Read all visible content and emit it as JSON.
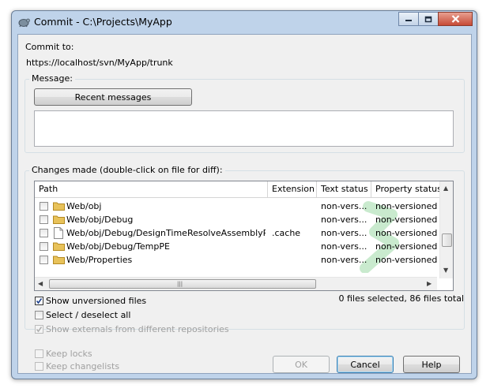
{
  "window": {
    "title": "Commit - C:\\Projects\\MyApp"
  },
  "commit_to": {
    "label": "Commit to:",
    "url": "https://localhost/svn/MyApp/trunk"
  },
  "message": {
    "group_label": "Message:",
    "recent_button": "Recent messages",
    "text": ""
  },
  "changes": {
    "group_label": "Changes made (double-click on file for diff):",
    "columns": [
      "Path",
      "Extension",
      "Text status",
      "Property status"
    ],
    "rows": [
      {
        "path": "Web/obj",
        "extension": "",
        "text_status": "non-vers...",
        "property_status": "non-versioned",
        "icon": "folder-icon"
      },
      {
        "path": "Web/obj/Debug",
        "extension": "",
        "text_status": "non-vers...",
        "property_status": "non-versioned",
        "icon": "folder-icon"
      },
      {
        "path": "Web/obj/Debug/DesignTimeResolveAssemblyRef...",
        "extension": ".cache",
        "text_status": "non-vers...",
        "property_status": "non-versioned",
        "icon": "file-icon"
      },
      {
        "path": "Web/obj/Debug/TempPE",
        "extension": "",
        "text_status": "non-vers...",
        "property_status": "non-versioned",
        "icon": "folder-icon"
      },
      {
        "path": "Web/Properties",
        "extension": "",
        "text_status": "non-vers...",
        "property_status": "non-versioned",
        "icon": "folder-icon"
      }
    ],
    "summary": "0 files selected, 86 files total"
  },
  "options": {
    "show_unversioned": "Show unversioned files",
    "select_deselect_all": "Select / deselect all",
    "show_externals": "Show externals from different repositories",
    "keep_locks": "Keep locks",
    "keep_changelists": "Keep changelists"
  },
  "buttons": {
    "ok": "OK",
    "cancel": "Cancel",
    "help": "Help"
  },
  "colors": {
    "frame": "#bfd3ea",
    "client": "#f0f0f0",
    "close_button": "#c74a36",
    "folder": "#e8c25a"
  }
}
